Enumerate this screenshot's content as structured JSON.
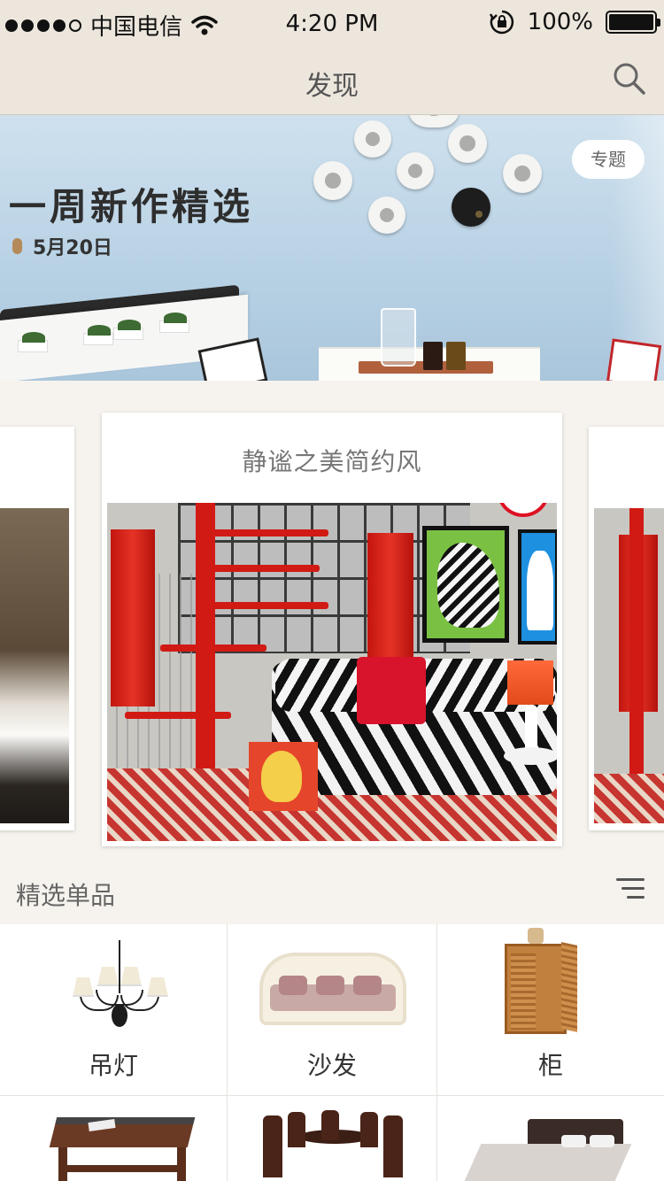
{
  "status_bar": {
    "carrier": "中国电信",
    "time": "4:20 PM",
    "battery": "100%",
    "signal_bars_filled": 4,
    "signal_bars_total": 5
  },
  "nav": {
    "title": "发现",
    "search_icon": "search-icon"
  },
  "banner": {
    "headline": "一周新作精选",
    "date": "5月20日",
    "tag": "专题"
  },
  "carousel": {
    "active_title": "静谧之美简约风"
  },
  "section": {
    "title": "精选单品",
    "menu_icon": "filter-menu-icon"
  },
  "products": [
    {
      "label": "吊灯",
      "icon": "chandelier"
    },
    {
      "label": "沙发",
      "icon": "sofa"
    },
    {
      "label": "柜",
      "icon": "cabinet"
    },
    {
      "label": "",
      "icon": "coffee-table"
    },
    {
      "label": "",
      "icon": "dining-set"
    },
    {
      "label": "",
      "icon": "bed"
    }
  ],
  "colors": {
    "nav_bg": "#ece6dd",
    "page_bg": "#f6f3ee",
    "accent_red": "#d11a14"
  }
}
